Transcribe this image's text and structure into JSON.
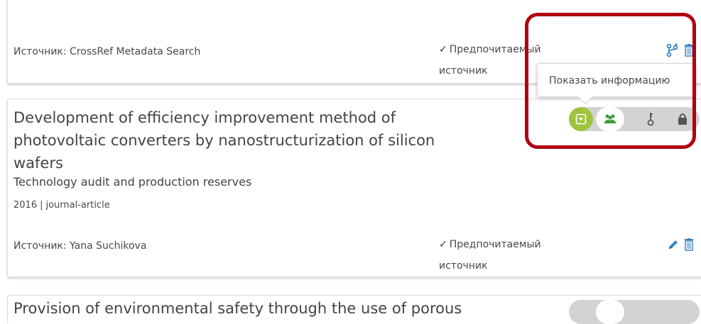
{
  "top_card": {
    "source_label": "Источник: CrossRef Metadata Search",
    "preferred_check": "✓",
    "preferred_line1": "Предпочитаемый",
    "preferred_line2": "источник",
    "icons": [
      "fork-icon",
      "delete-icon"
    ]
  },
  "tooltip": {
    "text": "Показать информацию"
  },
  "work": {
    "title_line1": "Development of efficiency improvement method of",
    "title_line2": "photovoltaic converters by nanostructurization of silicon",
    "title_line3": "wafers",
    "journal": "Technology audit and production reserves",
    "year": "2016",
    "separator": "|",
    "type": "journal-article",
    "source_label": "Источник: Yana Suchikova",
    "preferred_check": "✓",
    "preferred_line1": "Предпочитаемый",
    "preferred_line2": "источник",
    "visibility": {
      "selected": "everyone",
      "options": [
        "everyone",
        "trusted-parties",
        "only-me"
      ]
    }
  },
  "next_work": {
    "title_partial": "Provision of environmental safety through the use of porous"
  },
  "colors": {
    "accent_blue": "#3a86c6",
    "visibility_green": "#9ec33d",
    "highlight_red": "#b00010"
  }
}
